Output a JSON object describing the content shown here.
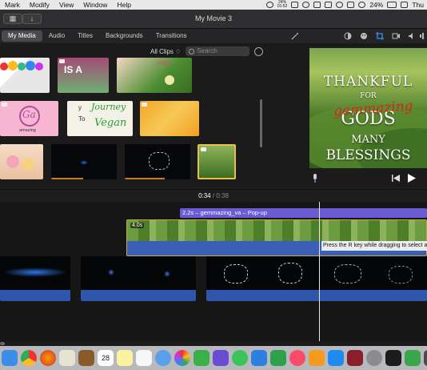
{
  "menubar": {
    "items": [
      "Mark",
      "Modify",
      "View",
      "Window",
      "Help"
    ],
    "battery_small_top": "24%",
    "battery_small_bottom": "01:52",
    "battery_percent": "24%",
    "clock": "Thu "
  },
  "window": {
    "title": "My Movie 3"
  },
  "tabs": [
    "My Media",
    "Audio",
    "Titles",
    "Backgrounds",
    "Transitions"
  ],
  "browser": {
    "filter": "All Clips ♢",
    "search_placeholder": "Search",
    "thumb_labels": {
      "isa": "IS A",
      "shop": "shop",
      "ga": "Ga",
      "amazing": "amazing",
      "journey": "Journey",
      "y": "y",
      "to": "To",
      "vegan": "Vegan"
    }
  },
  "viewer": {
    "lines": [
      "THANKFUL",
      "FOR",
      "GODS",
      "MANY",
      "BLESSINGS"
    ],
    "watermark": "gemmazing"
  },
  "timeline": {
    "current_time": "0:34",
    "separator": "/",
    "total_time": "0:38",
    "title_clip_label": "2.2s – gemmazing_va – Pop-up",
    "clip_duration": "4.0s",
    "hint": "Press the R key while dragging to select a s"
  },
  "dock": {
    "calendar_day": "28",
    "icons": [
      "finder-icon",
      "chrome-icon",
      "firefox-icon",
      "maps-icon",
      "notes-brown-icon",
      "calendar-icon",
      "notes-icon",
      "list-icon",
      "preview-icon",
      "facetime-icon",
      "photos-icon",
      "imovie-icon",
      "messages-icon",
      "keynote-icon",
      "numbers-icon",
      "music-icon",
      "books-icon",
      "appstore-icon",
      "photobooth-icon",
      "settings-icon",
      "activity-monitor-icon",
      "evernote-icon",
      "scripts-icon"
    ]
  },
  "colors": {
    "title_clip": "#6a5bd4",
    "primary_track": "#3a5fb8",
    "watermark": "#d8261b"
  }
}
